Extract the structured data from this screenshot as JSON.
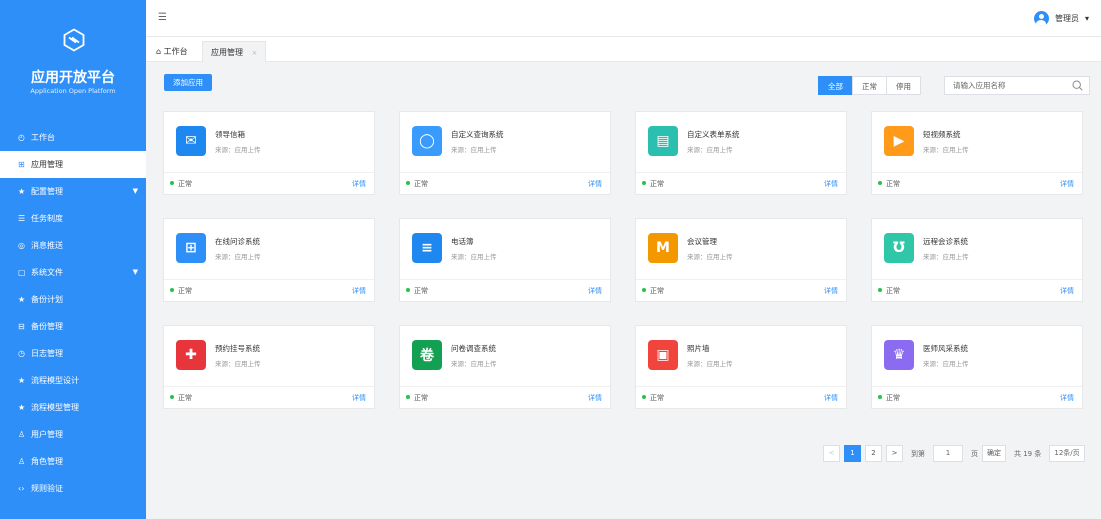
{
  "brand": {
    "title": "应用开放平台",
    "subtitle": "Application Open Platform"
  },
  "menu": [
    {
      "label": "工作台",
      "icon": "dashboard-icon",
      "glyph": "◴"
    },
    {
      "label": "应用管理",
      "icon": "apps-grid-icon",
      "glyph": "⊞",
      "active": true
    },
    {
      "label": "配置管理",
      "icon": "star-icon",
      "glyph": "★",
      "expandable": true
    },
    {
      "label": "任务制度",
      "icon": "list-icon",
      "glyph": "☰"
    },
    {
      "label": "消息推送",
      "icon": "message-icon",
      "glyph": "◎"
    },
    {
      "label": "系统文件",
      "icon": "file-icon",
      "glyph": "▢",
      "expandable": true
    },
    {
      "label": "备份计划",
      "icon": "star-icon",
      "glyph": "★"
    },
    {
      "label": "备份管理",
      "icon": "backup-icon",
      "glyph": "⊟"
    },
    {
      "label": "日志管理",
      "icon": "clock-icon",
      "glyph": "◷"
    },
    {
      "label": "流程模型设计",
      "icon": "star-icon",
      "glyph": "★"
    },
    {
      "label": "流程模型管理",
      "icon": "star-icon",
      "glyph": "★"
    },
    {
      "label": "用户管理",
      "icon": "users-icon",
      "glyph": "♙"
    },
    {
      "label": "角色管理",
      "icon": "role-icon",
      "glyph": "♙"
    },
    {
      "label": "规则验证",
      "icon": "code-icon",
      "glyph": "‹›"
    }
  ],
  "topbar": {
    "user": "管理员",
    "caret": "▾",
    "menu_glyph": "☰"
  },
  "tabs": [
    {
      "label": "工作台",
      "glyph": "⌂"
    },
    {
      "label": "应用管理",
      "close": "×"
    }
  ],
  "toolbar": {
    "add_label": "添加应用",
    "filters": [
      {
        "label": "全部",
        "active": true
      },
      {
        "label": "正常"
      },
      {
        "label": "停用"
      }
    ],
    "search_placeholder": "请输入应用名称"
  },
  "apps": [
    {
      "name": "领导信箱",
      "source": "来源：应用上传",
      "status": "正常",
      "detail": "详情",
      "icon": "mail-icon",
      "color": "#1e88f0",
      "glyph": "✉"
    },
    {
      "name": "自定义查询系统",
      "source": "来源：应用上传",
      "status": "正常",
      "detail": "详情",
      "icon": "search-icon",
      "color": "#3a9bff",
      "glyph": "◯"
    },
    {
      "name": "自定义表单系统",
      "source": "来源：应用上传",
      "status": "正常",
      "detail": "详情",
      "icon": "form-icon",
      "color": "#2bbfb0",
      "glyph": "▤"
    },
    {
      "name": "短视频系统",
      "source": "来源：应用上传",
      "status": "正常",
      "detail": "详情",
      "icon": "play-icon",
      "color": "#ff9a1a",
      "glyph": "▶"
    },
    {
      "name": "在线问诊系统",
      "source": "来源：应用上传",
      "status": "正常",
      "detail": "详情",
      "icon": "monitor-icon",
      "color": "#2f8ff9",
      "glyph": "⊞"
    },
    {
      "name": "电话簿",
      "source": "来源：应用上传",
      "status": "正常",
      "detail": "详情",
      "icon": "phonebook-icon",
      "color": "#1e88f0",
      "glyph": "≡"
    },
    {
      "name": "会议管理",
      "source": "来源：应用上传",
      "status": "正常",
      "detail": "详情",
      "icon": "meeting-icon",
      "color": "#f39800",
      "glyph": "M"
    },
    {
      "name": "远程会诊系统",
      "source": "来源：应用上传",
      "status": "正常",
      "detail": "详情",
      "icon": "stethoscope-icon",
      "color": "#2fc7a8",
      "glyph": "Ʊ"
    },
    {
      "name": "预约挂号系统",
      "source": "来源：应用上传",
      "status": "正常",
      "detail": "详情",
      "icon": "medical-cross-icon",
      "color": "#e8353c",
      "glyph": "✚"
    },
    {
      "name": "问卷调查系统",
      "source": "来源：应用上传",
      "status": "正常",
      "detail": "详情",
      "icon": "survey-icon",
      "color": "#14a052",
      "glyph": "卷"
    },
    {
      "name": "照片墙",
      "source": "来源：应用上传",
      "status": "正常",
      "detail": "详情",
      "icon": "image-icon",
      "color": "#f0443c",
      "glyph": "▣"
    },
    {
      "name": "医师风采系统",
      "source": "来源：应用上传",
      "status": "正常",
      "detail": "详情",
      "icon": "doctor-icon",
      "color": "#8b6cf0",
      "glyph": "♛"
    }
  ],
  "pagination": {
    "prev": "<",
    "pages": [
      "1",
      "2"
    ],
    "current": "1",
    "next": ">",
    "goto_label": "到第",
    "goto_value": "1",
    "page_unit": "页",
    "confirm": "确定",
    "total": "共 19 条",
    "page_size": "12条/页"
  }
}
